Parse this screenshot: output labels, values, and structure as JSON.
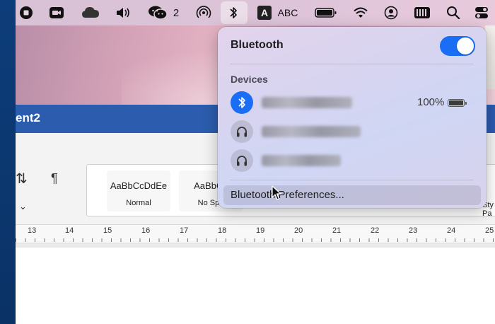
{
  "menubar": {
    "wechat_count": "2",
    "input_source_letter": "A",
    "input_source_label": "ABC",
    "icons": [
      "stop-icon",
      "video-icon",
      "cloud-icon",
      "volume-icon",
      "wechat-icon",
      "airdrop-icon",
      "bluetooth-icon",
      "input-source-icon",
      "battery-icon",
      "wifi-icon",
      "user-icon",
      "keyboard-icon",
      "search-icon",
      "control-center-icon"
    ]
  },
  "word": {
    "doc_title": "ent2",
    "styles": [
      {
        "preview": "AaBbCcDdEe",
        "name": "Normal"
      },
      {
        "preview": "AaBbCc",
        "name": "No Spa"
      }
    ],
    "style_right_1": "Sty",
    "style_right_2": "Pa",
    "ruler_numbers": [
      "13",
      "14",
      "15",
      "16",
      "17",
      "18",
      "19",
      "20",
      "21",
      "22",
      "23",
      "24",
      "25"
    ]
  },
  "bluetooth": {
    "title": "Bluetooth",
    "enabled": true,
    "section_label": "Devices",
    "devices": [
      {
        "name_blurred": true,
        "connected": true,
        "battery": "100%",
        "icon": "bluetooth-icon"
      },
      {
        "name_blurred": true,
        "connected": false,
        "icon": "headphones-icon"
      },
      {
        "name_blurred": true,
        "connected": false,
        "icon": "headphones-icon"
      }
    ],
    "preferences_label": "Bluetooth Preferences..."
  },
  "colors": {
    "accent_blue": "#1a6ef5",
    "word_blue": "#2b5cad"
  }
}
